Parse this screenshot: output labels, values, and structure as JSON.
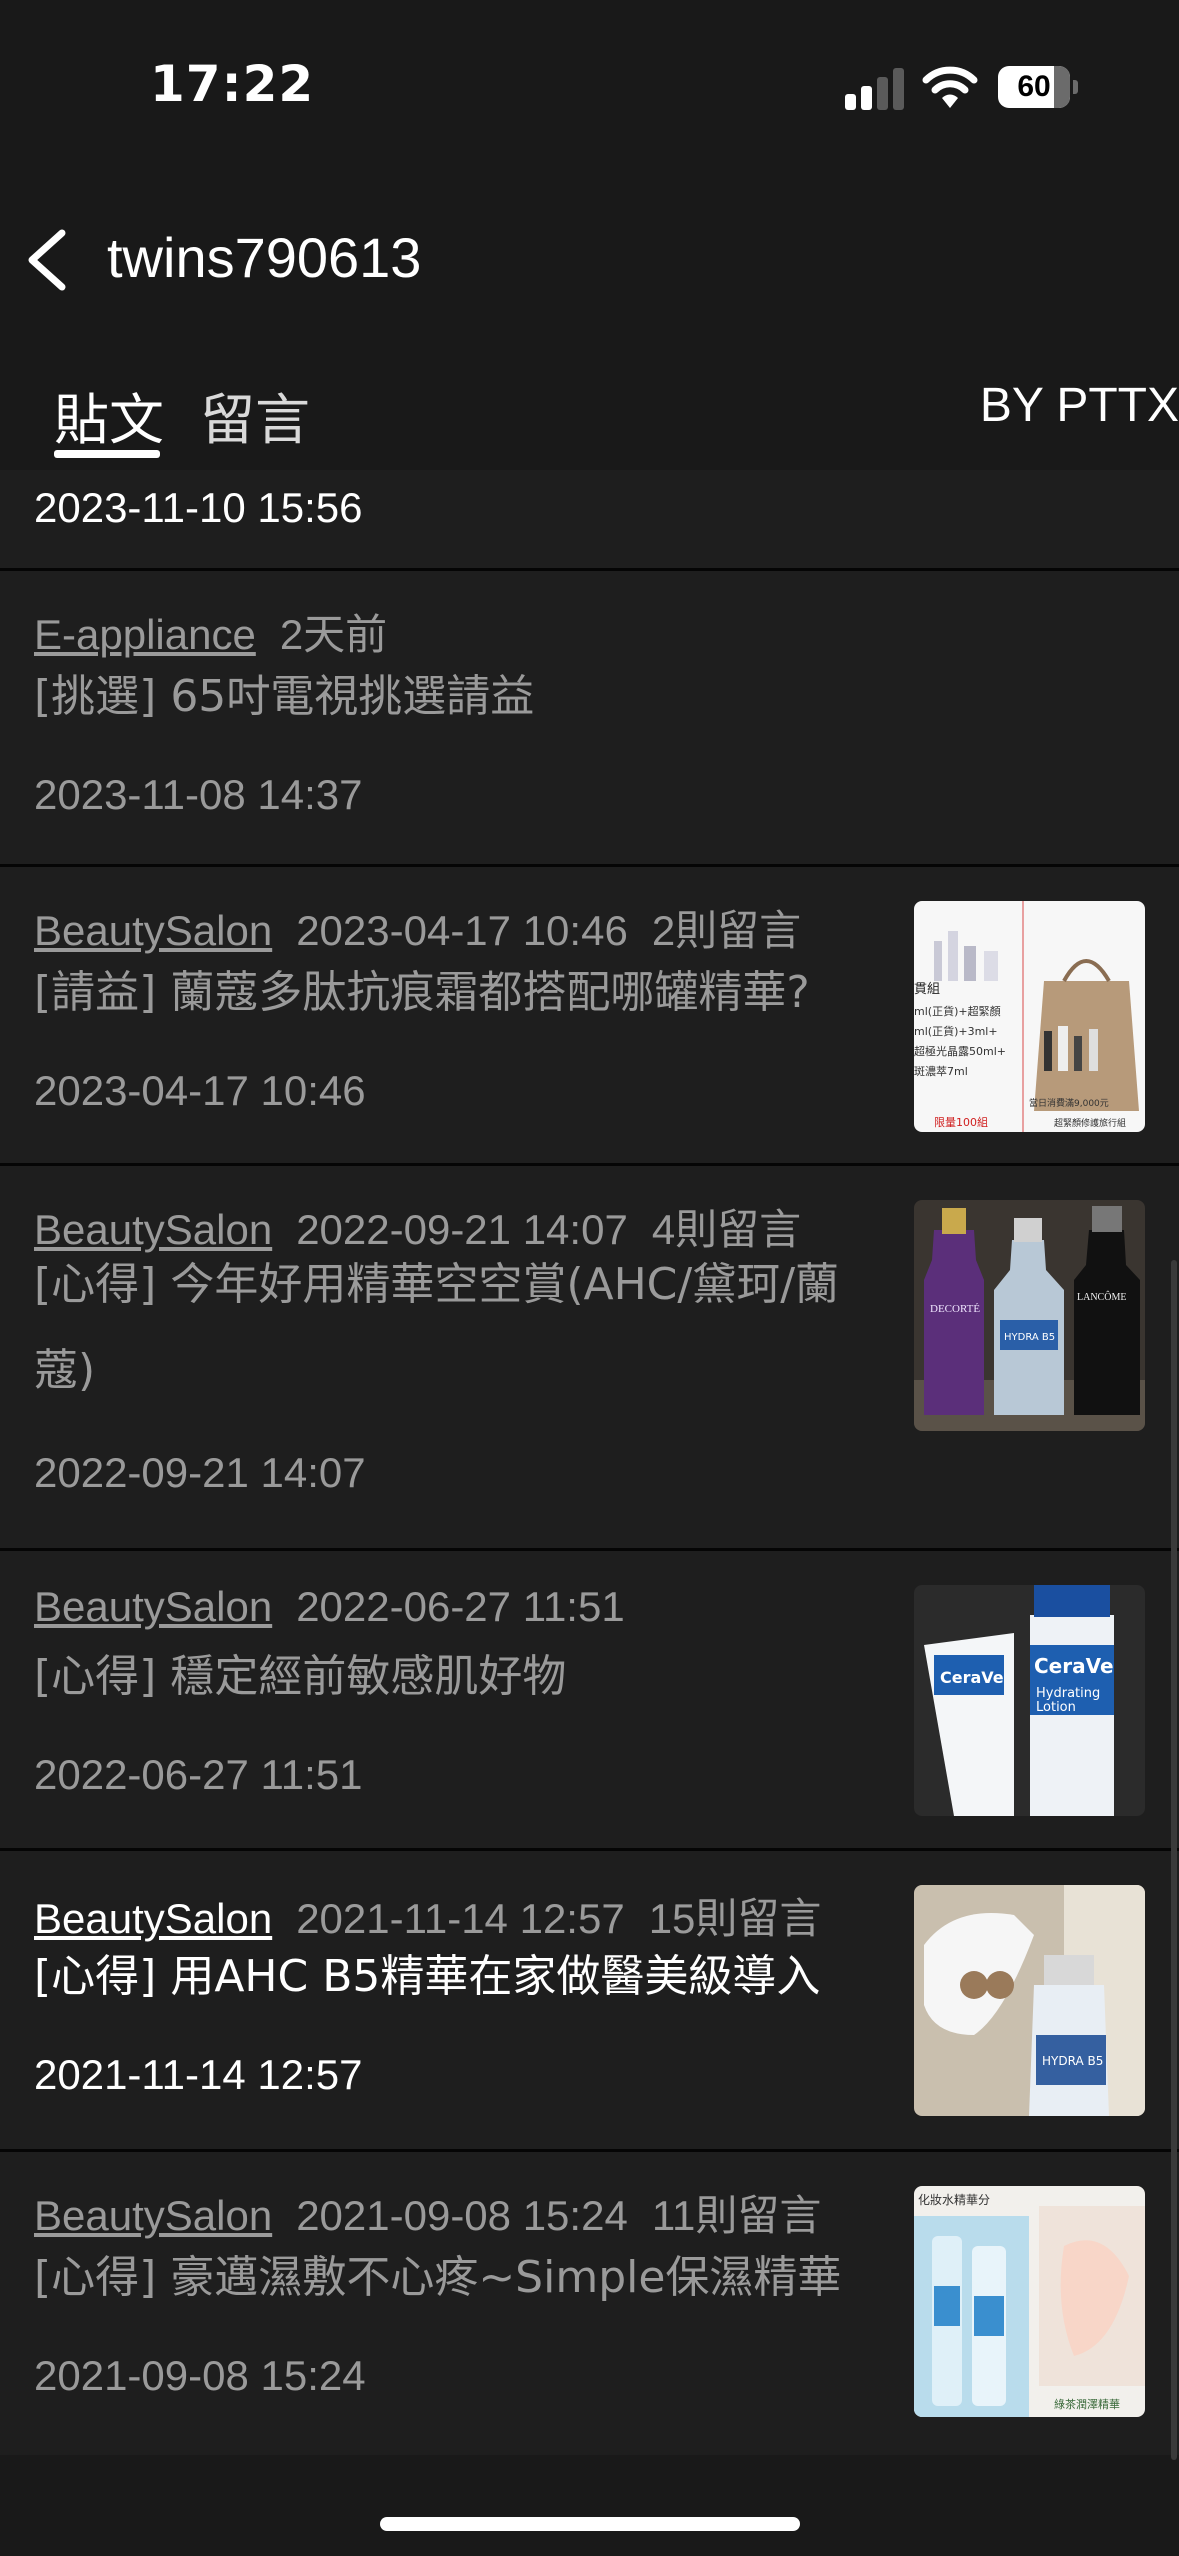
{
  "status_bar": {
    "time": "17:22",
    "battery": "60"
  },
  "header": {
    "title": "twins790613"
  },
  "tabs": [
    {
      "label": "貼文",
      "active": true
    },
    {
      "label": "留言",
      "active": false
    }
  ],
  "by_label": "BY PTTX",
  "posts": [
    {
      "date": "2023-11-10 15:56"
    },
    {
      "board": "E-appliance",
      "relative_time": "2天前",
      "comments": "",
      "title": "[挑選] 65吋電視挑選請益",
      "date": "2023-11-08 14:37"
    },
    {
      "board": "BeautySalon",
      "relative_time": "2023-04-17 10:46",
      "comments": "2則留言",
      "title": "[請益] 蘭蔻多肽抗痕霜都搭配哪罐精華?",
      "date": "2023-04-17 10:46"
    },
    {
      "board": "BeautySalon",
      "relative_time": "2022-09-21 14:07",
      "comments": "4則留言",
      "title": "[心得] 今年好用精華空空賞(AHC/黛珂/蘭蔻)",
      "date": "2022-09-21 14:07"
    },
    {
      "board": "BeautySalon",
      "relative_time": "2022-06-27 11:51",
      "comments": "",
      "title": "[心得] 穩定經前敏感肌好物",
      "date": "2022-06-27 11:51"
    },
    {
      "board": "BeautySalon",
      "relative_time": "2021-11-14 12:57",
      "comments": "15則留言",
      "title": "[心得] 用AHC B5精華在家做醫美級導入",
      "date": "2021-11-14 12:57"
    },
    {
      "board": "BeautySalon",
      "relative_time": "2021-09-08 15:24",
      "comments": "11則留言",
      "title": "[心得] 豪邁濕敷不心疼~Simple保濕精華",
      "date": "2021-09-08 15:24"
    }
  ],
  "thumb_text": {
    "lancome_1": "貫組",
    "lancome_2": "ml(正貨)+超緊顏",
    "lancome_3": "ml(正貨)+3ml+",
    "lancome_4": "超極光晶露50ml+",
    "lancome_5": "斑濃萃7ml",
    "lancome_6": "當日消費滿9,000元",
    "lancome_7": "限量100組",
    "lancome_8": "超緊顏修護旅行組",
    "decorte": "DECORTÉ",
    "hydra": "HYDRA B5",
    "lancome": "LANCÔME",
    "cerave_1": "CeraVe",
    "cerave_2": "CeraVe",
    "cerave_3": "Hydrating",
    "cerave_4": "Lotion",
    "ahc_hydra": "HYDRA B5",
    "simple_top": "化妝水精華分",
    "simple_bottom": "綠茶潤澤精華"
  }
}
